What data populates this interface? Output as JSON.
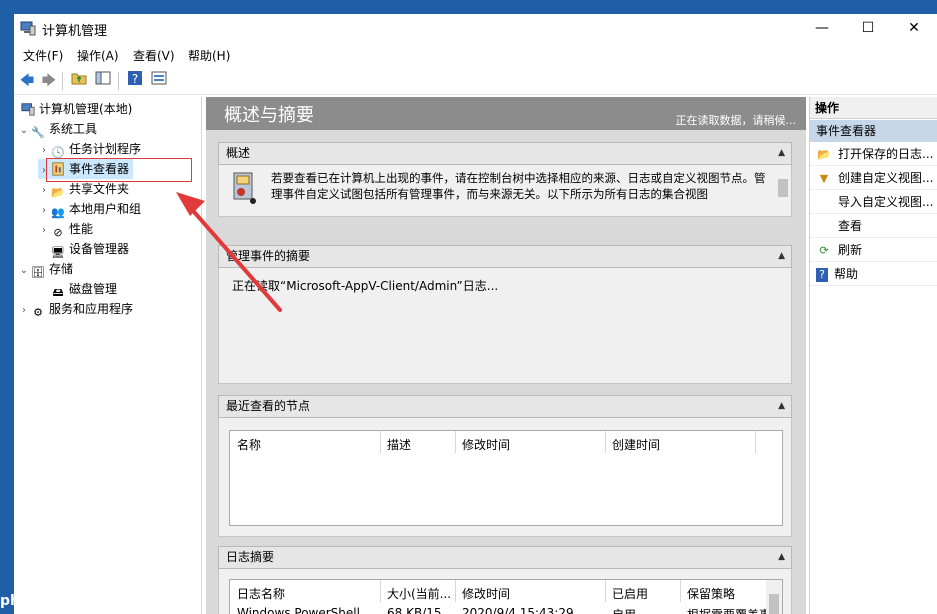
{
  "window": {
    "title": "计算机管理",
    "minimize": "—",
    "maximize": "☐",
    "close": "✕"
  },
  "menu": [
    "文件(F)",
    "操作(A)",
    "查看(V)",
    "帮助(H)"
  ],
  "tree": {
    "root": "计算机管理(本地)",
    "system_tools": "系统工具",
    "task_scheduler": "任务计划程序",
    "event_viewer": "事件查看器",
    "shared_folders": "共享文件夹",
    "local_users": "本地用户和组",
    "performance": "性能",
    "device_manager": "设备管理器",
    "storage": "存储",
    "disk_management": "磁盘管理",
    "services": "服务和应用程序"
  },
  "center": {
    "banner_title": "概述与摘要",
    "banner_status": "正在读取数据，请稍候...",
    "overview_header": "概述",
    "overview_text": "若要查看已在计算机上出现的事件，请在控制台树中选择相应的来源、日志或自定义视图节点。管理事件自定义试图包括所有管理事件，而与来源无关。以下所示为所有日志的集合视图",
    "summary_header": "管理事件的摘要",
    "summary_status": "正在读取“Microsoft-AppV-Client/Admin”日志...",
    "recent_header": "最近查看的节点",
    "recent_cols": [
      "名称",
      "描述",
      "修改时间",
      "创建时间"
    ],
    "log_header": "日志摘要",
    "log_cols": [
      "日志名称",
      "大小(当前...",
      "修改时间",
      "已启用",
      "保留策略"
    ],
    "log_row": [
      "Windows PowerShell",
      "68 KB/15...",
      "2020/9/4 15:43:29",
      "启用",
      "根据需要覆盖事"
    ]
  },
  "actions": {
    "header": "操作",
    "section": "事件查看器",
    "items": [
      "打开保存的日志...",
      "创建自定义视图...",
      "导入自定义视图...",
      "查看",
      "刷新",
      "帮助"
    ]
  },
  "watermark": "php 中文网",
  "colors": {
    "banner": "#8c8c8c",
    "selection": "#cce8ff",
    "annotation": "#e23a3a",
    "action_section": "#c6d7ea"
  }
}
